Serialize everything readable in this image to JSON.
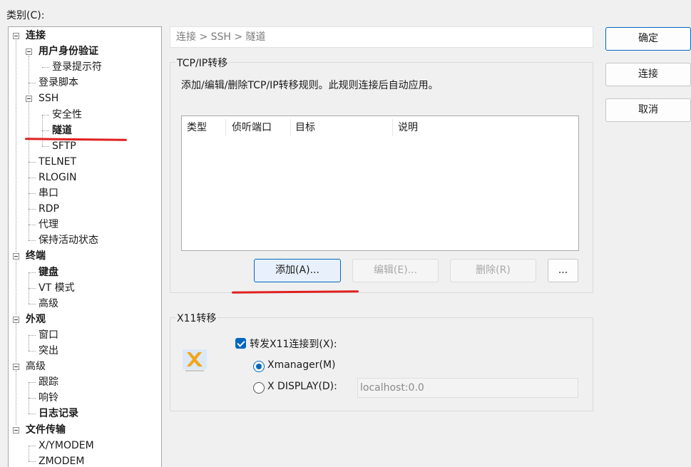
{
  "dialog": {
    "category_label": "类别(C):"
  },
  "tree": [
    {
      "label": "连接",
      "level": 0,
      "bold": true,
      "expander": true
    },
    {
      "label": "用户身份验证",
      "level": 1,
      "bold": true,
      "expander": true
    },
    {
      "label": "登录提示符",
      "level": 2,
      "bold": false
    },
    {
      "label": "登录脚本",
      "level": 1,
      "bold": false
    },
    {
      "label": "SSH",
      "level": 1,
      "bold": false,
      "expander": true
    },
    {
      "label": "安全性",
      "level": 2,
      "bold": false
    },
    {
      "label": "隧道",
      "level": 2,
      "bold": true,
      "selected": true
    },
    {
      "label": "SFTP",
      "level": 2,
      "bold": false
    },
    {
      "label": "TELNET",
      "level": 1,
      "bold": false
    },
    {
      "label": "RLOGIN",
      "level": 1,
      "bold": false
    },
    {
      "label": "串口",
      "level": 1,
      "bold": false
    },
    {
      "label": "RDP",
      "level": 1,
      "bold": false
    },
    {
      "label": "代理",
      "level": 1,
      "bold": false
    },
    {
      "label": "保持活动状态",
      "level": 1,
      "bold": false
    },
    {
      "label": "终端",
      "level": 0,
      "bold": true,
      "expander": true
    },
    {
      "label": "键盘",
      "level": 1,
      "bold": true
    },
    {
      "label": "VT 模式",
      "level": 1,
      "bold": false
    },
    {
      "label": "高级",
      "level": 1,
      "bold": false
    },
    {
      "label": "外观",
      "level": 0,
      "bold": true,
      "expander": true
    },
    {
      "label": "窗口",
      "level": 1,
      "bold": false
    },
    {
      "label": "突出",
      "level": 1,
      "bold": false
    },
    {
      "label": "高级",
      "level": 0,
      "bold": false,
      "expander": true
    },
    {
      "label": "跟踪",
      "level": 1,
      "bold": false
    },
    {
      "label": "响铃",
      "level": 1,
      "bold": false
    },
    {
      "label": "日志记录",
      "level": 1,
      "bold": true
    },
    {
      "label": "文件传输",
      "level": 0,
      "bold": true,
      "expander": true
    },
    {
      "label": "X/YMODEM",
      "level": 1,
      "bold": false
    },
    {
      "label": "ZMODEM",
      "level": 1,
      "bold": false
    }
  ],
  "breadcrumb": "连接 > SSH > 隧道",
  "tcp": {
    "group_title": "TCP/IP转移",
    "description": "添加/编辑/删除TCP/IP转移规则。此规则连接后自动应用。",
    "columns": [
      "类型",
      "侦听端口",
      "目标",
      "说明"
    ],
    "add_button": "添加(A)...",
    "edit_button": "编辑(E)...",
    "delete_button": "删除(R)",
    "more_button": "..."
  },
  "x11": {
    "group_title": "X11转移",
    "forward_checkbox": "转发X11连接到(X):",
    "forward_checked": true,
    "xmanager_radio": "Xmanager(M)",
    "xdisplay_radio": "X DISPLAY(D):",
    "xdisplay_value": "localhost:0.0",
    "selected": "xmanager"
  },
  "buttons": {
    "ok": "确定",
    "connect": "连接",
    "cancel": "取消"
  },
  "colors": {
    "accent": "#0067c0",
    "annotation": "#e02020"
  }
}
